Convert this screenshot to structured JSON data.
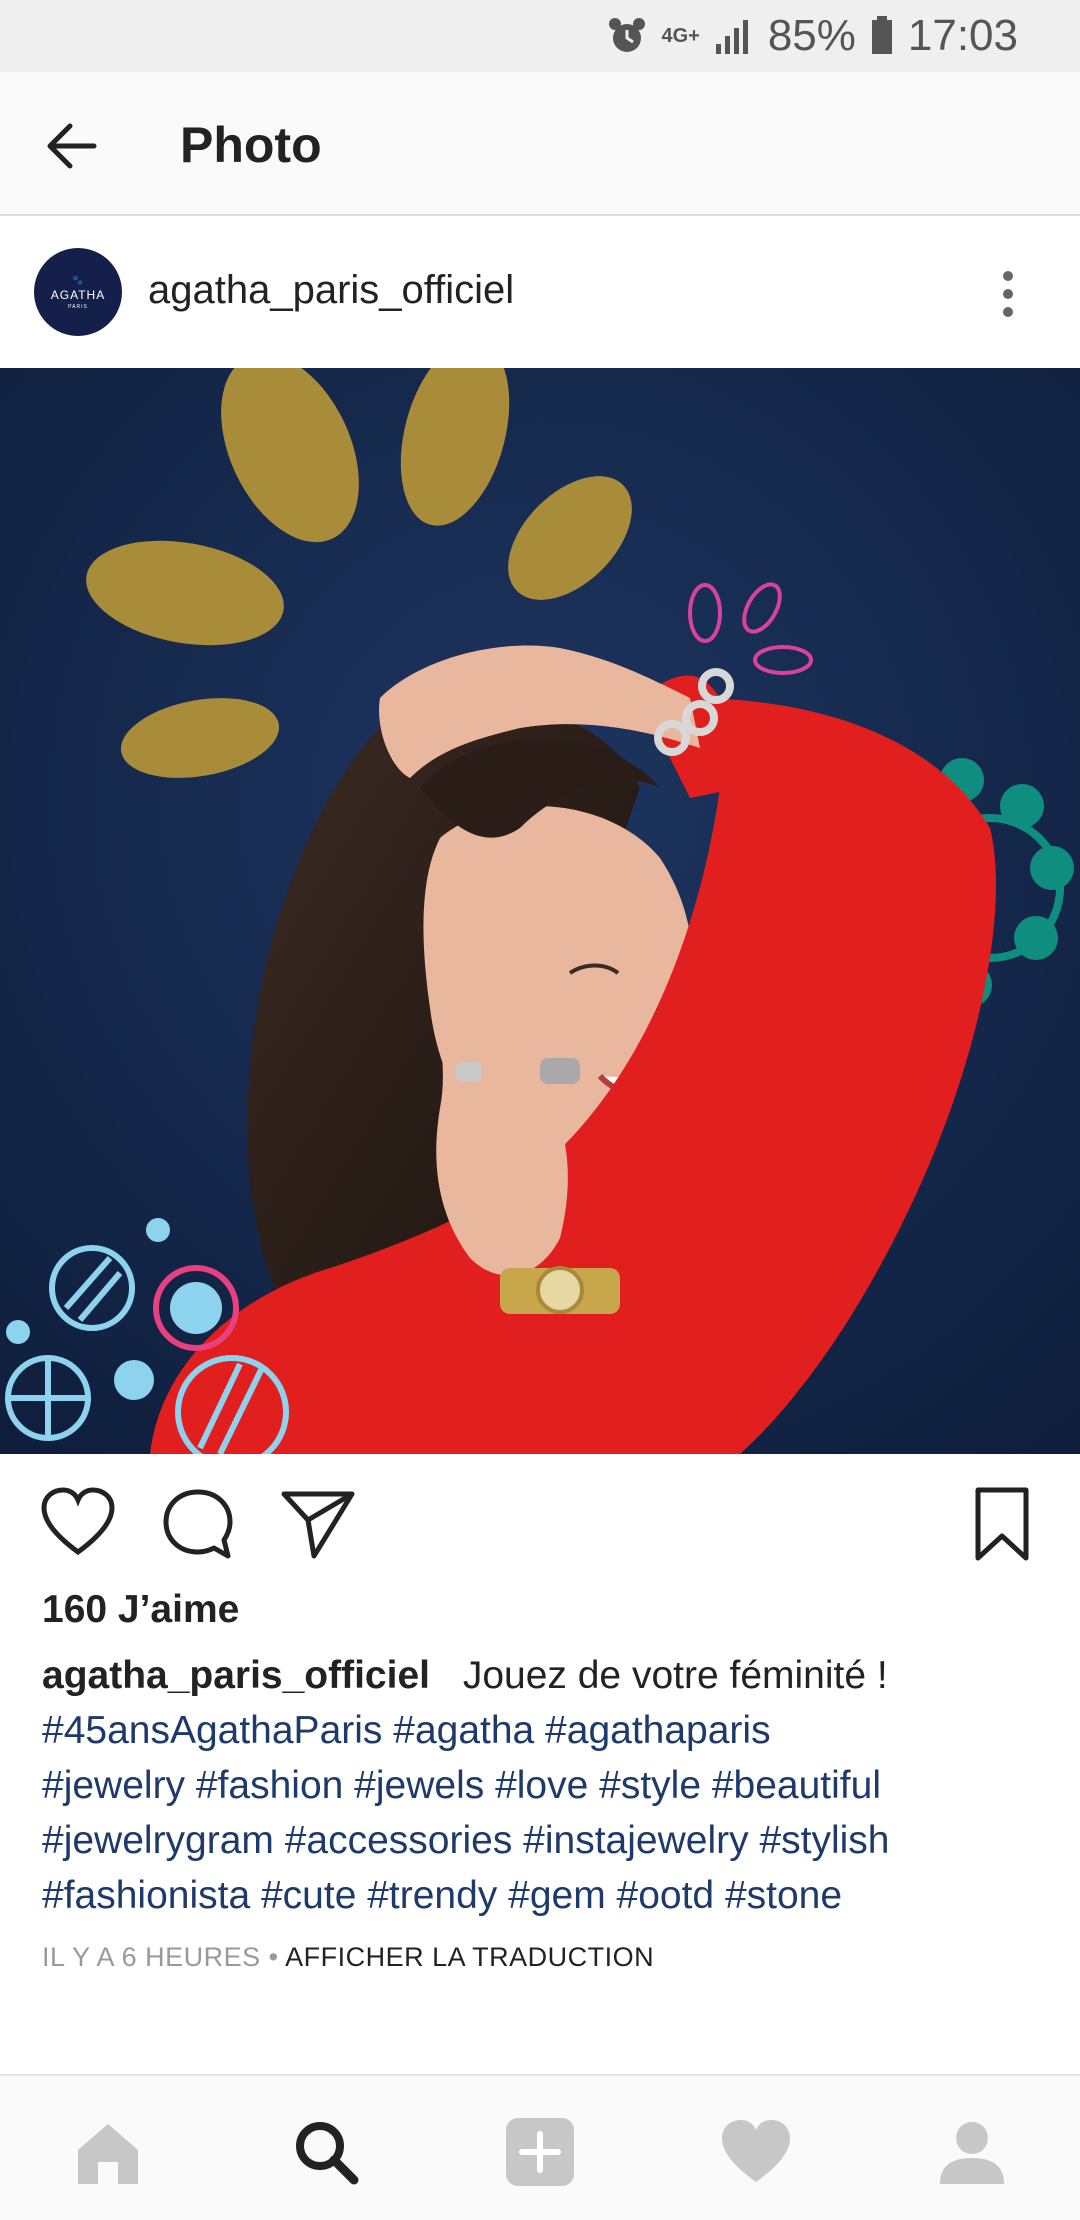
{
  "status_bar": {
    "network": "4G+",
    "battery": "85%",
    "time": "17:03",
    "icons": [
      "alarm-icon",
      "signal-icon",
      "battery-icon"
    ]
  },
  "app_bar": {
    "title": "Photo",
    "back_icon": "arrow-left-icon"
  },
  "post": {
    "avatar_text": {
      "brand": "AGATHA",
      "sub": "PARIS"
    },
    "username": "agatha_paris_officiel",
    "more_icon": "vertical-dots-icon",
    "actions": [
      "heart-icon",
      "comment-icon",
      "share-icon",
      "bookmark-icon"
    ],
    "likes": "160 J’aime",
    "caption": {
      "username": "agatha_paris_officiel",
      "text": "Jouez de votre féminité !",
      "tags_line1": "#45ansAgathaParis #agatha #agathaparis",
      "tags_line2": "#jewelry #fashion #jewels #love #style #beautiful",
      "tags_line3": "#jewelrygram #accessories #instajewelry #stylish",
      "tags_line4": "#fashionista #cute #trendy #gem #ootd #stone"
    },
    "time_ago": "IL Y A 6 HEURES",
    "separator": " • ",
    "translate": "AFFICHER LA TRADUCTION"
  },
  "bottom_nav": [
    "home-icon",
    "search-icon",
    "add-icon",
    "heart-icon",
    "profile-icon"
  ],
  "colors": {
    "photo_bg": "#16294d",
    "leaf_gold": "#a88c3a",
    "sweater_red": "#e21f1f",
    "hashtag_blue": "#1d3a6b",
    "teal_dots": "#0f8e7f"
  }
}
